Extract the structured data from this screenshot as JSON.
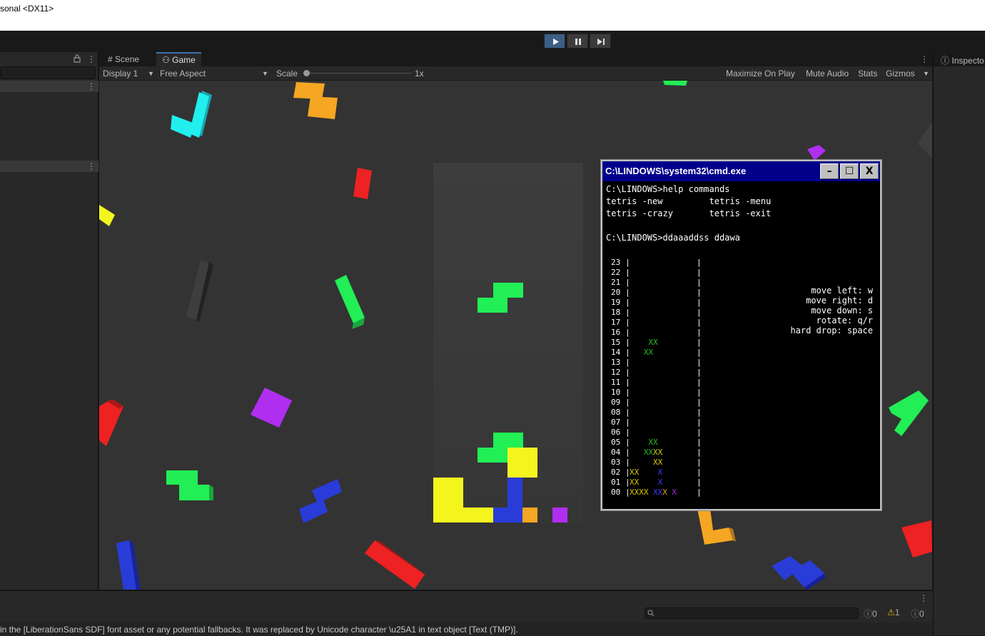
{
  "window": {
    "title": "sonal <DX11>"
  },
  "tabs": [
    {
      "label": "Scene"
    },
    {
      "label": "Game"
    }
  ],
  "gamebar": {
    "display": "Display 1",
    "aspect": "Free Aspect",
    "scale_label": "Scale",
    "scale_value": "1x",
    "maximize": "Maximize On Play",
    "mute": "Mute Audio",
    "stats": "Stats",
    "gizmos": "Gizmos"
  },
  "inspector": {
    "label": "Inspecto"
  },
  "cmd": {
    "title": "C:\\LINDOWS\\system32\\cmd.exe",
    "lines": [
      "C:\\LINDOWS>help commands",
      "tetris -new         tetris -menu",
      "tetris -crazy       tetris -exit",
      "",
      "C:\\LINDOWS>ddaaaddss ddawa"
    ],
    "rows": [
      "23",
      "22",
      "21",
      "20",
      "19",
      "18",
      "17",
      "16",
      "15",
      "14",
      "13",
      "12",
      "11",
      "10",
      "09",
      "08",
      "07",
      "06",
      "05",
      "04",
      "03",
      "02",
      "01",
      "00"
    ],
    "controls": [
      "move left: w",
      "move right: d",
      "move down: s",
      "rotate: q/r",
      "hard drop: space"
    ],
    "cells": [
      {
        "row": 15,
        "col": 4,
        "text": "XX",
        "color": "#1fbf1f"
      },
      {
        "row": 14,
        "col": 3,
        "text": "XX",
        "color": "#1fbf1f"
      },
      {
        "row": 5,
        "col": 4,
        "text": "XX",
        "color": "#1fbf1f"
      },
      {
        "row": 4,
        "col": 3,
        "text": "XX",
        "color": "#1fbf1f"
      },
      {
        "row": 4,
        "col": 5,
        "text": "XX",
        "color": "#d8c800"
      },
      {
        "row": 3,
        "col": 5,
        "text": "XX",
        "color": "#d8c800"
      },
      {
        "row": 2,
        "col": 0,
        "text": "XX",
        "color": "#d8c800"
      },
      {
        "row": 2,
        "col": 6,
        "text": "X",
        "color": "#3a3aff"
      },
      {
        "row": 1,
        "col": 0,
        "text": "XX",
        "color": "#d8c800"
      },
      {
        "row": 1,
        "col": 6,
        "text": "X",
        "color": "#3a3aff"
      },
      {
        "row": 0,
        "col": 0,
        "text": "XXXX",
        "color": "#d8c800"
      },
      {
        "row": 0,
        "col": 5,
        "text": "XX",
        "color": "#3a3aff"
      },
      {
        "row": 0,
        "col": 7,
        "text": "X",
        "color": "#e89a1c"
      },
      {
        "row": 0,
        "col": 9,
        "text": "X",
        "color": "#a530e0"
      }
    ]
  },
  "console": {
    "message": "in the [LiberationSans SDF] font asset or any potential fallbacks. It was replaced by Unicode character \\u25A1 in text object [Text (TMP)].",
    "info_count": "0",
    "warn_count": "1",
    "error_count": "0"
  },
  "colors": {
    "accent": "#3a72b0",
    "cmd_title_bg": "#00008b",
    "yellow": "#f5f51e",
    "green": "#22ee55",
    "blue": "#2a3cd8",
    "orange": "#f5a623",
    "purple": "#b02ef0",
    "red": "#ee2222",
    "cyan": "#22eeee"
  }
}
